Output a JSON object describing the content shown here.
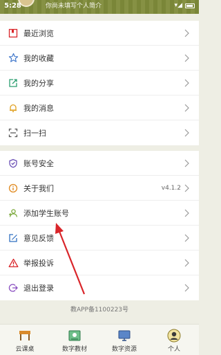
{
  "status_bar": {
    "time": "5:28",
    "signal": "▾◢"
  },
  "header": {
    "subtitle": "你尚未填写个人简介"
  },
  "menu_group1": [
    {
      "name": "recent-browse",
      "label": "最近浏览",
      "icon": "bookmark-icon"
    },
    {
      "name": "my-favorites",
      "label": "我的收藏",
      "icon": "star-icon"
    },
    {
      "name": "my-shares",
      "label": "我的分享",
      "icon": "share-icon"
    },
    {
      "name": "my-messages",
      "label": "我的消息",
      "icon": "bell-icon"
    },
    {
      "name": "scan",
      "label": "扫一扫",
      "icon": "scan-icon"
    }
  ],
  "menu_group2": [
    {
      "name": "account-security",
      "label": "账号安全",
      "icon": "shield-icon"
    },
    {
      "name": "about-us",
      "label": "关于我们",
      "icon": "info-icon",
      "version": "v4.1.2"
    },
    {
      "name": "add-student-account",
      "label": "添加学生账号",
      "icon": "add-user-icon"
    },
    {
      "name": "feedback",
      "label": "意见反馈",
      "icon": "edit-icon"
    },
    {
      "name": "report",
      "label": "举报投诉",
      "icon": "warning-icon"
    },
    {
      "name": "logout",
      "label": "退出登录",
      "icon": "logout-icon"
    }
  ],
  "footer_note": "教APP备1100223号",
  "tabs": [
    {
      "name": "tab-cloud-class",
      "label": "云课桌",
      "icon": "desk-icon"
    },
    {
      "name": "tab-digital-textbook",
      "label": "数字教材",
      "icon": "book-icon"
    },
    {
      "name": "tab-digital-resources",
      "label": "数字资源",
      "icon": "monitor-icon"
    },
    {
      "name": "tab-profile",
      "label": "个人",
      "icon": "profile-icon",
      "active": true
    }
  ],
  "colors": {
    "header": "#7f8b3a",
    "accent_red": "#d9252a",
    "icon_blue": "#3a73c9",
    "icon_green": "#4f9a3e"
  }
}
